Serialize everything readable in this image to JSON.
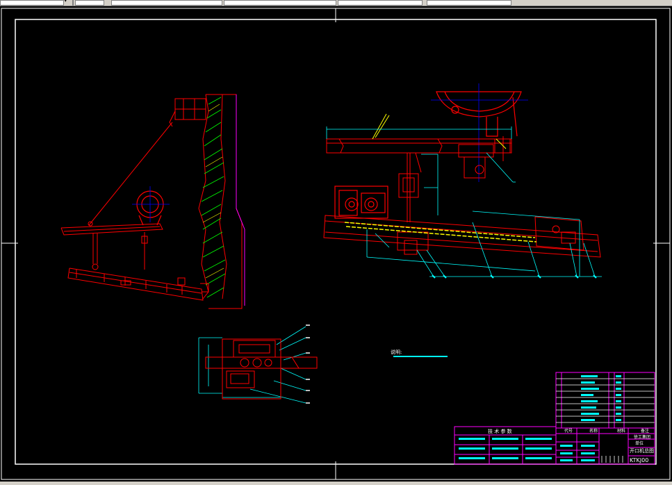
{
  "toolbar": {
    "caret_label": "▾"
  },
  "drawing": {
    "note_label": "说明:",
    "tech_params_title": "技 术 参 数",
    "bom_header": {
      "code": "代号",
      "name": "名称",
      "material": "材料",
      "remark": "备注"
    },
    "title_block": {
      "company": "徐工集团",
      "unit": "单位",
      "drawing_name": "开口机总图",
      "drawing_number": "KTKJ00"
    }
  },
  "colors": {
    "background": "#000000",
    "frame": "#ffffff",
    "part_red": "#ff0000",
    "dimension_cyan": "#00ffff",
    "hatch_green": "#00ff00",
    "hatch_yellow": "#ffff00",
    "outline_magenta": "#ff00ff"
  }
}
